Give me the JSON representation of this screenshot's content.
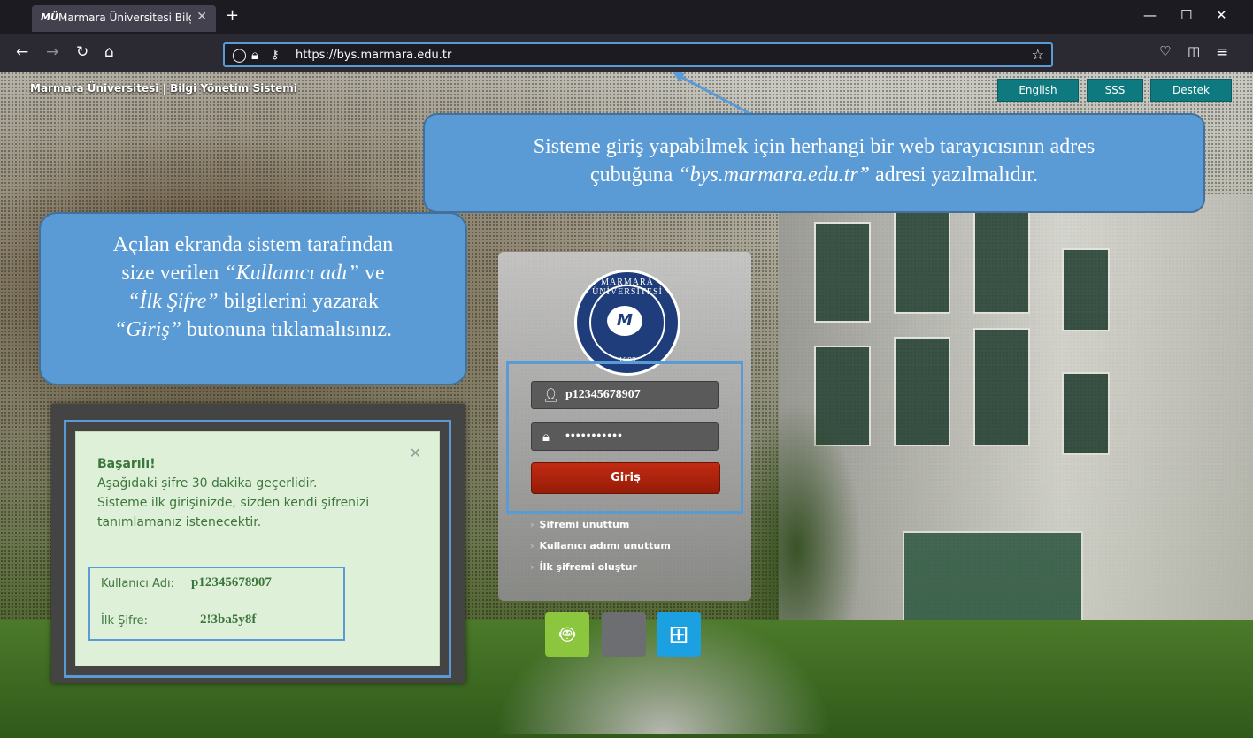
{
  "browser": {
    "tab_title": "Marmara Üniversitesi Bilgi Yöne",
    "tab_favicon": "MÜ",
    "url": "https://bys.marmara.edu.tr"
  },
  "header": {
    "site_title": "Marmara Üniversitesi | Bilgi Yönetim Sistemi",
    "buttons": [
      "English",
      "SSS",
      "Destek"
    ]
  },
  "callouts": {
    "top": {
      "line1": "Sisteme giriş yapabilmek için herhangi bir web tarayıcısının adres",
      "line2_pre": "çubuğuna ",
      "line2_em": "“bys.marmara.edu.tr”",
      "line2_post": " adresi yazılmalıdır."
    },
    "left": {
      "line1": "Açılan ekranda sistem tarafından",
      "line2_pre": "size verilen ",
      "line2_em": "“Kullanıcı adı”",
      "line2_post": " ve",
      "line3_em": "“İlk Şifre”",
      "line3_post": " bilgilerini yazarak",
      "line4_em": "“Giriş”",
      "line4_post": " butonuna tıklamalısınız."
    }
  },
  "login": {
    "logo_text": "MARMARA ÜNİVERSİTESİ",
    "logo_year": "1883",
    "username": "p12345678907",
    "password": "•••••••••••",
    "submit": "Giriş",
    "links": [
      "Şifremi unuttum",
      "Kullanıcı adımı unuttum",
      "İlk şifremi oluştur"
    ]
  },
  "apps": [
    {
      "icon": "android-icon",
      "color": "#8cc63f"
    },
    {
      "icon": "apple-icon",
      "color": "#6d6e71"
    },
    {
      "icon": "windows-icon",
      "color": "#1ba1e2"
    }
  ],
  "success": {
    "title": "Başarılı!",
    "lines": [
      "Aşağıdaki şifre 30 dakika geçerlidir.",
      "Sisteme ilk girişinizde, sizden kendi şifrenizi",
      "tanımlamanız istenecektir."
    ],
    "username_label": "Kullanıcı Adı:",
    "username_value": "p12345678907",
    "password_label": "İlk Şifre:",
    "password_value": "2!3ba5y8f"
  },
  "colors": {
    "accent": "#5b9bd5",
    "header_button": "#0e7a80",
    "login_button": "#b3230d",
    "success_bg": "#dff0d8"
  }
}
